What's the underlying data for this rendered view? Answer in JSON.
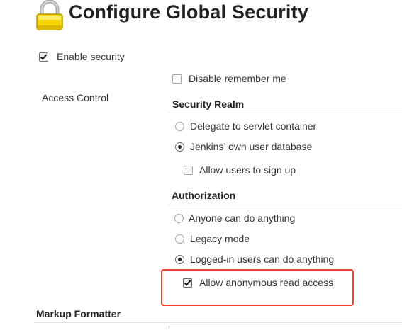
{
  "header": {
    "title": "Configure Global Security",
    "icon": "lock-icon"
  },
  "enable_security": {
    "label": "Enable security",
    "checked": true
  },
  "access_control": {
    "label": "Access Control",
    "disable_remember_me": {
      "label": "Disable remember me",
      "checked": false
    }
  },
  "security_realm": {
    "header": "Security Realm",
    "options": [
      {
        "label": "Delegate to servlet container",
        "selected": false
      },
      {
        "label": "Jenkins’ own user database",
        "selected": true
      }
    ],
    "allow_signup": {
      "label": "Allow users to sign up",
      "checked": false
    }
  },
  "authorization": {
    "header": "Authorization",
    "options": [
      {
        "label": "Anyone can do anything",
        "selected": false
      },
      {
        "label": "Legacy mode",
        "selected": false
      },
      {
        "label": "Logged-in users can do anything",
        "selected": true
      }
    ],
    "allow_anonymous_read": {
      "label": "Allow anonymous read access",
      "checked": true
    }
  },
  "markup_formatter": {
    "header": "Markup Formatter"
  },
  "colors": {
    "highlight": "#e8442f",
    "lock_body": "#f5d400",
    "lock_shackle": "#a8a8a8"
  }
}
